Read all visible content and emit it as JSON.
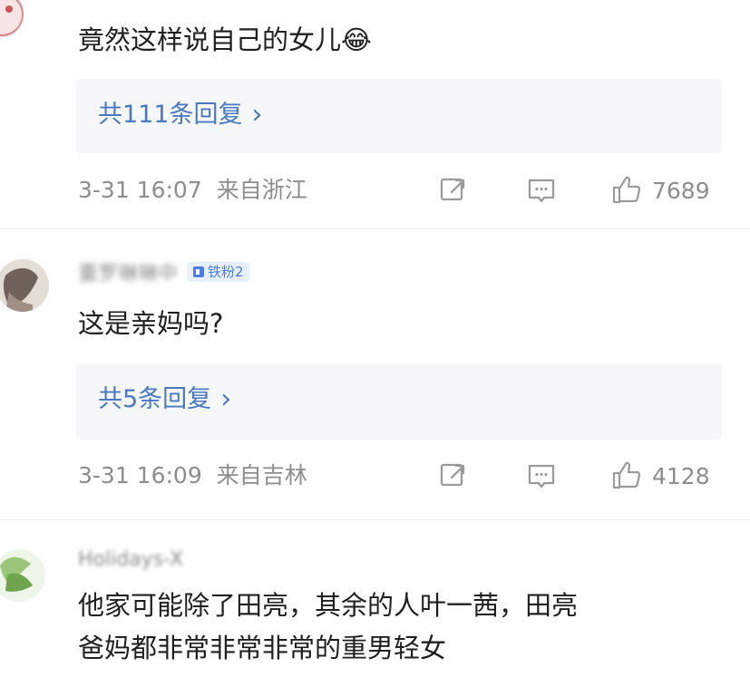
{
  "comments": [
    {
      "text": "竟然这样说自己的女儿😂",
      "reply_label": "共111条回复",
      "timestamp": "3-31 16:07",
      "location": "来自浙江",
      "likes": "7689"
    },
    {
      "author": "重罗琳琳中",
      "badge": "铁粉2",
      "text": "这是亲妈吗?",
      "reply_label": "共5条回复",
      "timestamp": "3-31 16:09",
      "location": "来自吉林",
      "likes": "4128"
    },
    {
      "author": "Holidays-X",
      "text_lines": [
        "他家可能除了田亮，其余的人叶一茜，田亮",
        "爸妈都非常非常非常的重男轻女"
      ]
    }
  ]
}
